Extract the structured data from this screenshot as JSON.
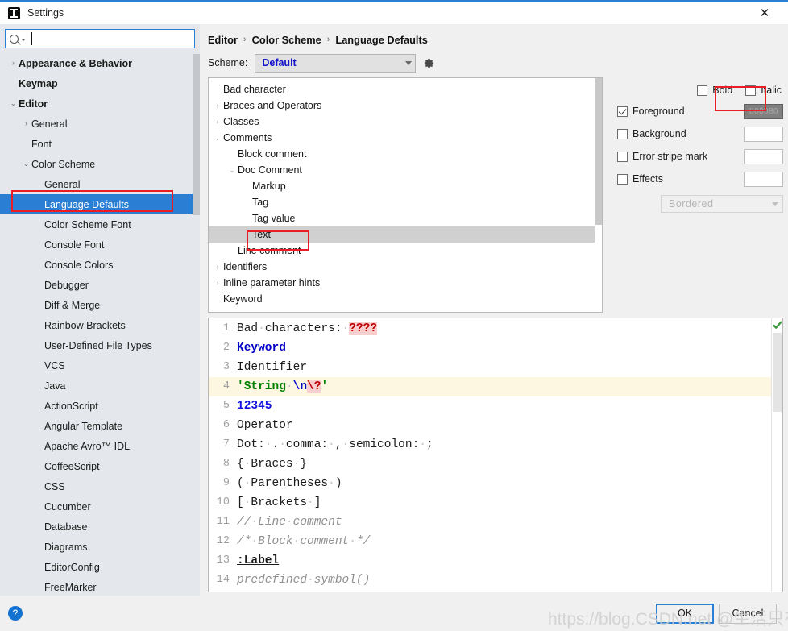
{
  "window": {
    "title": "Settings",
    "app_icon": "intellij-logo-icon",
    "close_label": "✕"
  },
  "search": {
    "placeholder": "",
    "value": "",
    "icon": "search-icon"
  },
  "sidebar": {
    "items": [
      {
        "label": "Appearance & Behavior",
        "level": 0,
        "arrow": "›",
        "bold": true,
        "selected": false
      },
      {
        "label": "Keymap",
        "level": 0,
        "arrow": "",
        "bold": true,
        "selected": false
      },
      {
        "label": "Editor",
        "level": 0,
        "arrow": "⌄",
        "bold": true,
        "selected": false
      },
      {
        "label": "General",
        "level": 1,
        "arrow": "›",
        "bold": false,
        "selected": false
      },
      {
        "label": "Font",
        "level": 1,
        "arrow": "",
        "bold": false,
        "selected": false
      },
      {
        "label": "Color Scheme",
        "level": 1,
        "arrow": "⌄",
        "bold": false,
        "selected": false
      },
      {
        "label": "General",
        "level": 2,
        "arrow": "",
        "bold": false,
        "selected": false
      },
      {
        "label": "Language Defaults",
        "level": 2,
        "arrow": "",
        "bold": false,
        "selected": true
      },
      {
        "label": "Color Scheme Font",
        "level": 2,
        "arrow": "",
        "bold": false,
        "selected": false
      },
      {
        "label": "Console Font",
        "level": 2,
        "arrow": "",
        "bold": false,
        "selected": false
      },
      {
        "label": "Console Colors",
        "level": 2,
        "arrow": "",
        "bold": false,
        "selected": false
      },
      {
        "label": "Debugger",
        "level": 2,
        "arrow": "",
        "bold": false,
        "selected": false
      },
      {
        "label": "Diff & Merge",
        "level": 2,
        "arrow": "",
        "bold": false,
        "selected": false
      },
      {
        "label": "Rainbow Brackets",
        "level": 2,
        "arrow": "",
        "bold": false,
        "selected": false
      },
      {
        "label": "User-Defined File Types",
        "level": 2,
        "arrow": "",
        "bold": false,
        "selected": false
      },
      {
        "label": "VCS",
        "level": 2,
        "arrow": "",
        "bold": false,
        "selected": false
      },
      {
        "label": "Java",
        "level": 2,
        "arrow": "",
        "bold": false,
        "selected": false
      },
      {
        "label": "ActionScript",
        "level": 2,
        "arrow": "",
        "bold": false,
        "selected": false
      },
      {
        "label": "Angular Template",
        "level": 2,
        "arrow": "",
        "bold": false,
        "selected": false
      },
      {
        "label": "Apache Avro™ IDL",
        "level": 2,
        "arrow": "",
        "bold": false,
        "selected": false
      },
      {
        "label": "CoffeeScript",
        "level": 2,
        "arrow": "",
        "bold": false,
        "selected": false
      },
      {
        "label": "CSS",
        "level": 2,
        "arrow": "",
        "bold": false,
        "selected": false
      },
      {
        "label": "Cucumber",
        "level": 2,
        "arrow": "",
        "bold": false,
        "selected": false
      },
      {
        "label": "Database",
        "level": 2,
        "arrow": "",
        "bold": false,
        "selected": false
      },
      {
        "label": "Diagrams",
        "level": 2,
        "arrow": "",
        "bold": false,
        "selected": false
      },
      {
        "label": "EditorConfig",
        "level": 2,
        "arrow": "",
        "bold": false,
        "selected": false
      },
      {
        "label": "FreeMarker",
        "level": 2,
        "arrow": "",
        "bold": false,
        "selected": false
      }
    ]
  },
  "breadcrumb": {
    "items": [
      "Editor",
      "Color Scheme",
      "Language Defaults"
    ],
    "separator": "›"
  },
  "scheme": {
    "label": "Scheme:",
    "value": "Default",
    "gear_icon": "gear-icon"
  },
  "color_tree": {
    "rows": [
      {
        "label": "Bad character",
        "level": 0,
        "arrow": "",
        "selected": false
      },
      {
        "label": "Braces and Operators",
        "level": 0,
        "arrow": "›",
        "selected": false
      },
      {
        "label": "Classes",
        "level": 0,
        "arrow": "›",
        "selected": false
      },
      {
        "label": "Comments",
        "level": 0,
        "arrow": "⌄",
        "selected": false
      },
      {
        "label": "Block comment",
        "level": 1,
        "arrow": "",
        "selected": false
      },
      {
        "label": "Doc Comment",
        "level": 1,
        "arrow": "⌄",
        "selected": false
      },
      {
        "label": "Markup",
        "level": 2,
        "arrow": "",
        "selected": false
      },
      {
        "label": "Tag",
        "level": 2,
        "arrow": "",
        "selected": false
      },
      {
        "label": "Tag value",
        "level": 2,
        "arrow": "",
        "selected": false
      },
      {
        "label": "Text",
        "level": 2,
        "arrow": "",
        "selected": true
      },
      {
        "label": "Line comment",
        "level": 1,
        "arrow": "",
        "selected": false
      },
      {
        "label": "Identifiers",
        "level": 0,
        "arrow": "›",
        "selected": false
      },
      {
        "label": "Inline parameter hints",
        "level": 0,
        "arrow": "›",
        "selected": false
      },
      {
        "label": "Keyword",
        "level": 0,
        "arrow": "",
        "selected": false
      }
    ]
  },
  "attributes": {
    "bold": {
      "label": "Bold",
      "checked": false
    },
    "italic": {
      "label": "Italic",
      "checked": false
    },
    "options": [
      {
        "label": "Foreground",
        "checked": true,
        "swatch_hex": "808080",
        "swatch_filled": true
      },
      {
        "label": "Background",
        "checked": false,
        "swatch_hex": "",
        "swatch_filled": false
      },
      {
        "label": "Error stripe mark",
        "checked": false,
        "swatch_hex": "",
        "swatch_filled": false
      },
      {
        "label": "Effects",
        "checked": false,
        "swatch_hex": "",
        "swatch_filled": false
      }
    ],
    "effects_type": {
      "value": "Bordered",
      "disabled": true
    }
  },
  "preview": {
    "inspection_icon": "green-check-icon",
    "lines": [
      {
        "n": "1",
        "plain": "Bad characters: ????"
      },
      {
        "n": "2",
        "plain": "Keyword"
      },
      {
        "n": "3",
        "plain": "Identifier"
      },
      {
        "n": "4",
        "plain": "'String \\n\\?'",
        "highlighted": true
      },
      {
        "n": "5",
        "plain": "12345"
      },
      {
        "n": "6",
        "plain": "Operator"
      },
      {
        "n": "7",
        "plain": "Dot: . comma: , semicolon: ;"
      },
      {
        "n": "8",
        "plain": "{ Braces }"
      },
      {
        "n": "9",
        "plain": "( Parentheses )"
      },
      {
        "n": "10",
        "plain": "[ Brackets ]"
      },
      {
        "n": "11",
        "plain": "// Line comment"
      },
      {
        "n": "12",
        "plain": "/* Block comment */"
      },
      {
        "n": "13",
        "plain": ":Label"
      },
      {
        "n": "14",
        "plain": "predefined symbol()"
      }
    ]
  },
  "footer": {
    "help_icon": "help-icon",
    "ok_label": "OK",
    "cancel_label": "Cancel"
  },
  "watermark": {
    "text": "https://blog.CSDN.net @生活只有苟且"
  },
  "colors": {
    "accent": "#2a7fd4",
    "annotation_red": "#ec1c24",
    "selected_row": "#2a7fd4",
    "foreground_swatch": "#808080"
  }
}
